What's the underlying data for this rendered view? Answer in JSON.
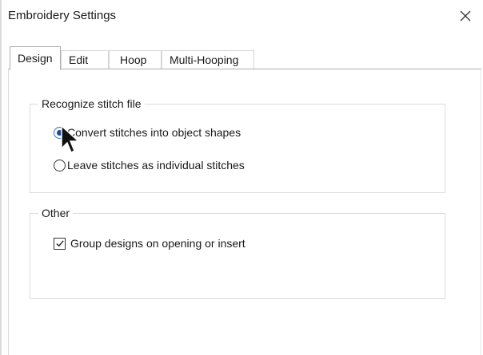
{
  "window": {
    "title": "Embroidery Settings",
    "close_icon": "close-icon"
  },
  "tabs": [
    {
      "label": "Design",
      "active": true
    },
    {
      "label": "Edit",
      "active": false
    },
    {
      "label": "Hoop",
      "active": false
    },
    {
      "label": "Multi-Hooping",
      "active": false
    }
  ],
  "groups": {
    "recognize": {
      "title": "Recognize stitch file",
      "options": [
        {
          "label": "Convert stitches into object shapes",
          "checked": true
        },
        {
          "label": "Leave stitches as individual stitches",
          "checked": false
        }
      ]
    },
    "other": {
      "title": "Other",
      "options": [
        {
          "label": "Group designs on opening or insert",
          "checked": true
        }
      ]
    }
  }
}
